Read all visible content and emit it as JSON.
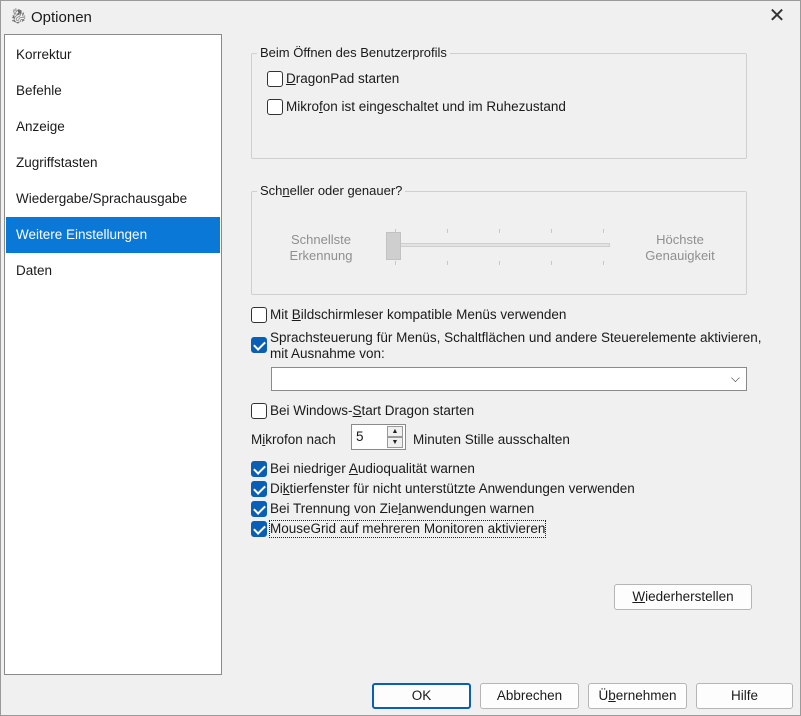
{
  "window": {
    "title": "Optionen",
    "close_label": "✕"
  },
  "sidebar": {
    "items": [
      {
        "label": "Korrektur"
      },
      {
        "label": "Befehle"
      },
      {
        "label": "Anzeige"
      },
      {
        "label": "Zugriffstasten"
      },
      {
        "label": "Wiedergabe/Sprachausgabe"
      },
      {
        "label": "Weitere Einstellungen",
        "selected": true
      },
      {
        "label": "Daten"
      }
    ]
  },
  "profile_group": {
    "legend": "Beim Öffnen des Benutzerprofils",
    "dragonpad": {
      "pre": "",
      "u": "D",
      "post": "ragonPad starten",
      "checked": false
    },
    "mic": {
      "pre": "Mikro",
      "u": "f",
      "post": "on ist eingeschaltet und im Ruhezustand",
      "checked": false
    }
  },
  "speed_group": {
    "legend_pre": "Sch",
    "legend_u": "n",
    "legend_post": "eller oder genauer?",
    "left_label_1": "Schnellste",
    "left_label_2": "Erkennung",
    "right_label_1": "Höchste",
    "right_label_2": "Genauigkeit"
  },
  "options": {
    "screenreader": {
      "pre": "Mit ",
      "u": "B",
      "post": "ildschirmleser kompatible Menüs verwenden",
      "checked": false
    },
    "voice_control_line1": "Sprachsteuerung für Menüs, Schaltflächen und andere Steuerelemente aktivieren,",
    "voice_control_line2": "mit Ausnahme von:",
    "voice_control_checked": true,
    "exception_value": "",
    "windows_start": {
      "pre": "Bei Windows-",
      "u": "S",
      "post": "tart Dragon starten",
      "checked": false
    },
    "mic_after_pre": "M",
    "mic_after_u": "i",
    "mic_after_post": "krofon nach",
    "mic_minutes": "5",
    "mic_after_suffix": "Minuten Stille ausschalten",
    "low_audio": {
      "pre": "Bei niedriger ",
      "u": "A",
      "post": "udioqualität warnen",
      "checked": true
    },
    "dictation": {
      "pre": "Di",
      "u": "k",
      "post": "tierfenster für nicht unterstützte Anwendungen verwenden",
      "checked": true
    },
    "disconnect": {
      "pre": "Bei Trennung von Zie",
      "u": "l",
      "post": "anwendungen warnen",
      "checked": true
    },
    "mousegrid": {
      "pre": "",
      "u": "",
      "post": "MouseGrid auf mehreren Monitoren aktivieren",
      "checked": true
    }
  },
  "buttons": {
    "restore_u": "W",
    "restore_post": "iederherstellen",
    "ok": "OK",
    "cancel": "Abbrechen",
    "apply_pre": "Ü",
    "apply_u": "b",
    "apply_post": "ernehmen",
    "help": "Hilfe"
  }
}
